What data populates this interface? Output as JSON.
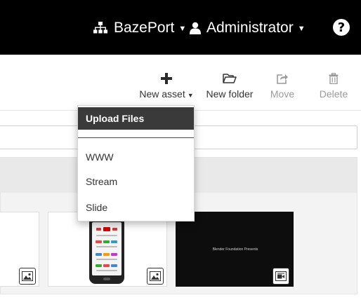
{
  "header": {
    "brand_label": "BazePort",
    "user_label": "Administrator",
    "help_glyph": "?"
  },
  "toolbar": {
    "new_asset_label": "New asset",
    "new_folder_label": "New folder",
    "move_label": "Move",
    "delete_label": "Delete"
  },
  "new_asset_menu": {
    "items": [
      {
        "label": "Upload Files",
        "active": true
      },
      {
        "label": "WWW"
      },
      {
        "label": "Stream"
      },
      {
        "label": "Slide"
      }
    ]
  },
  "search": {
    "value": "",
    "placeholder": ""
  },
  "assets": [
    {
      "type_icon": "image-icon"
    },
    {
      "type_icon": "image-icon",
      "thumb": "phone-screenshot"
    },
    {
      "type_icon": "video-icon",
      "thumb_text": "Blender Foundation Presents"
    }
  ],
  "colors": {
    "navbar_bg": "#000000",
    "menu_active_bg": "#3a3a3a",
    "panel_bg": "#f3f3f3",
    "disabled_text": "#9a9a9a"
  }
}
